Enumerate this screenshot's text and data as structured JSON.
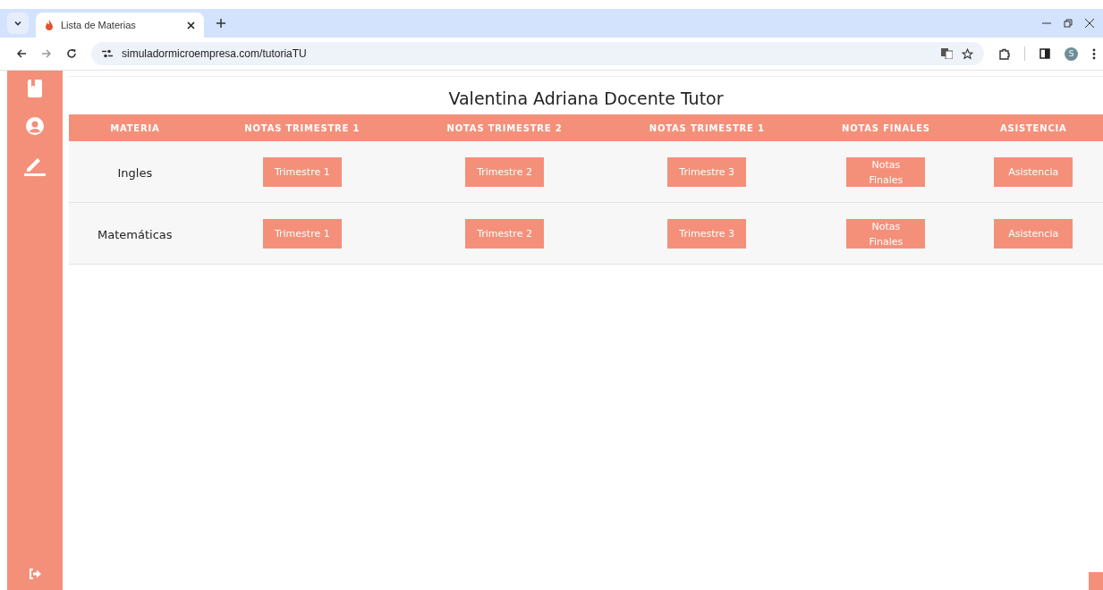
{
  "browser": {
    "tab": {
      "title": "Lista de Materias",
      "selected": true
    },
    "url": "simuladormicroempresa.com/tutoriaTU",
    "profile_letter": "S"
  },
  "page": {
    "title": "Valentina Adriana Docente Tutor"
  },
  "table": {
    "columns": [
      "MATERIA",
      "NOTAS TRIMESTRE 1",
      "NOTAS TRIMESTRE 2",
      "NOTAS TRIMESTRE 1",
      "NOTAS FINALES",
      "ASISTENCIA"
    ],
    "rows": [
      {
        "subject": "Ingles",
        "buttons": [
          "Trimestre 1",
          "Trimestre 2",
          "Trimestre 3",
          "Notas Finales",
          "Asistencia"
        ]
      },
      {
        "subject": "Matemáticas",
        "buttons": [
          "Trimestre 1",
          "Trimestre 2",
          "Trimestre 3",
          "Notas Finales",
          "Asistencia"
        ]
      }
    ]
  }
}
